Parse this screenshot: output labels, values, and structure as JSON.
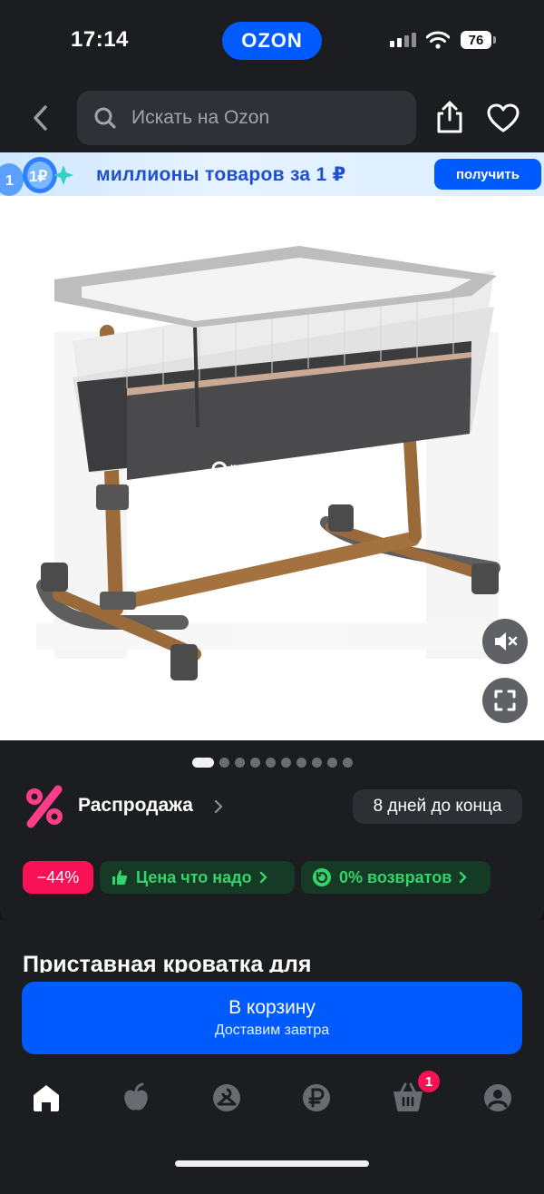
{
  "status_bar": {
    "time": "17:14",
    "battery": "76",
    "center_logo": "OZON"
  },
  "search": {
    "placeholder": "Искать на Ozon"
  },
  "icons": {
    "back": "chevron-left-icon",
    "search": "search-icon",
    "share": "share-icon",
    "favorite": "heart-icon",
    "mute": "mute-icon",
    "fullscreen": "fullscreen-icon"
  },
  "promo": {
    "coin_labels": [
      "1",
      "1₽"
    ],
    "text": "миллионы товаров за 1 ₽",
    "button": "получить"
  },
  "product_image": {
    "brand_mark": "lionelo",
    "slides_total": 10,
    "active_slide": 1
  },
  "sale": {
    "label": "Распродажа",
    "days_left": "8 дней до конца"
  },
  "badges": {
    "discount": "−44%",
    "good_price": "Цена что надо",
    "returns": "0% возвратов"
  },
  "product": {
    "title": "Приставная кроватка для"
  },
  "cart": {
    "button": "В корзину",
    "subtitle": "Доставим завтра"
  },
  "tabbar": {
    "items": [
      "home-icon",
      "fresh-icon",
      "catalog-icon",
      "ruble-icon",
      "cart-icon",
      "profile-icon"
    ],
    "cart_badge": "1"
  },
  "colors": {
    "accent": "#005bff",
    "sale": "#f91155",
    "green": "#33d46c",
    "background": "#1c1d21"
  }
}
